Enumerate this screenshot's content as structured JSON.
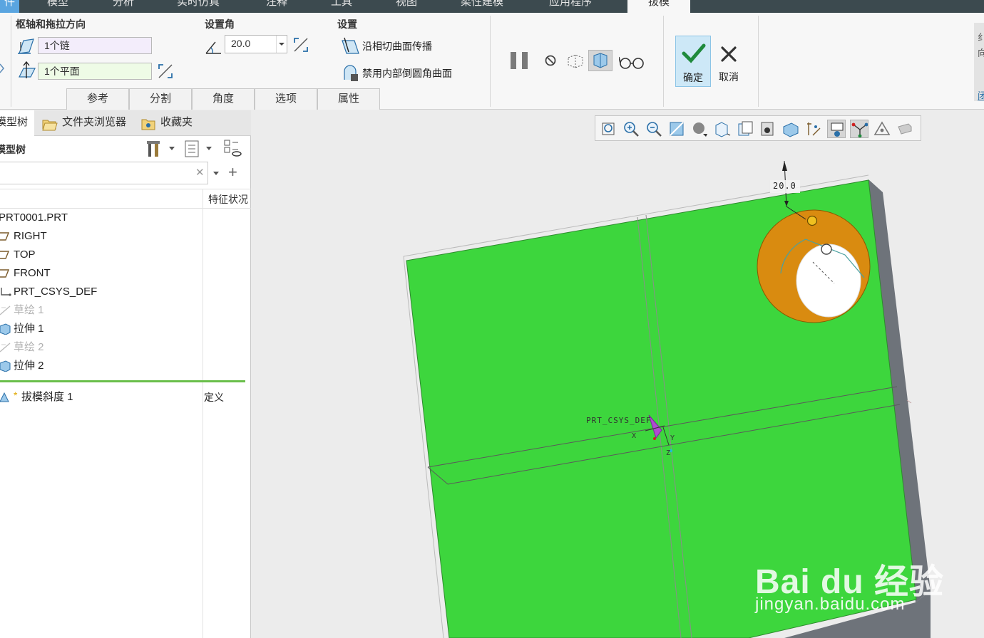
{
  "menu": {
    "tabs": [
      "件",
      "模型",
      "分析",
      "实时仿真",
      "注释",
      "工具",
      "视图",
      "柔性建模",
      "应用程序"
    ],
    "active_tab": "拔模"
  },
  "ribbon": {
    "pivot_group": {
      "title": "枢轴和拖拉方向",
      "surfaces_value": "1个链",
      "plane_value": "1个平面"
    },
    "angle_group": {
      "title": "设置角",
      "angle_value": "20.0"
    },
    "settings_group": {
      "title": "设置",
      "tangent_label": "沿相切曲面传播",
      "exclude_label": "禁用内部倒圆角曲面"
    },
    "confirm": {
      "ok_label": "确定",
      "cancel_label": "取消"
    },
    "subtabs": [
      "参考",
      "分割",
      "角度",
      "选项",
      "属性"
    ],
    "edge_text": [
      "纟",
      "向",
      "闭"
    ]
  },
  "left_panel": {
    "tabs": [
      "模型树",
      "文件夹浏览器",
      "收藏夹"
    ],
    "tree_title": "模型树",
    "column_header": "特征状况",
    "clear_symbol": "✕",
    "add_symbol": "+",
    "items": [
      {
        "label": "PRT0001.PRT",
        "icon": "part-icon",
        "status": ""
      },
      {
        "label": "RIGHT",
        "icon": "datum-plane-icon",
        "status": ""
      },
      {
        "label": "TOP",
        "icon": "datum-plane-icon",
        "status": ""
      },
      {
        "label": "FRONT",
        "icon": "datum-plane-icon",
        "status": ""
      },
      {
        "label": "PRT_CSYS_DEF",
        "icon": "csys-icon",
        "status": ""
      },
      {
        "label": "草绘 1",
        "icon": "sketch-icon",
        "status": ""
      },
      {
        "label": "拉伸 1",
        "icon": "extrude-icon",
        "status": ""
      },
      {
        "label": "草绘 2",
        "icon": "sketch-icon",
        "status": ""
      },
      {
        "label": "拉伸 2",
        "icon": "extrude-icon",
        "status": ""
      }
    ],
    "active_feature": {
      "label": "拔模斜度 1",
      "status": "定义",
      "marker": "*"
    }
  },
  "graphics": {
    "dimension_label": "20.0",
    "csys_label": "PRT_CSYS_DEF",
    "axis_x": "X",
    "axis_y": "Y",
    "axis_z": "Z",
    "watermark_brand": "Bai du 经验",
    "watermark_url": "jingyan.baidu.com",
    "colors": {
      "face": "#3dd63d",
      "draft_ring": "#d98b10",
      "side": "#6e737a"
    }
  }
}
